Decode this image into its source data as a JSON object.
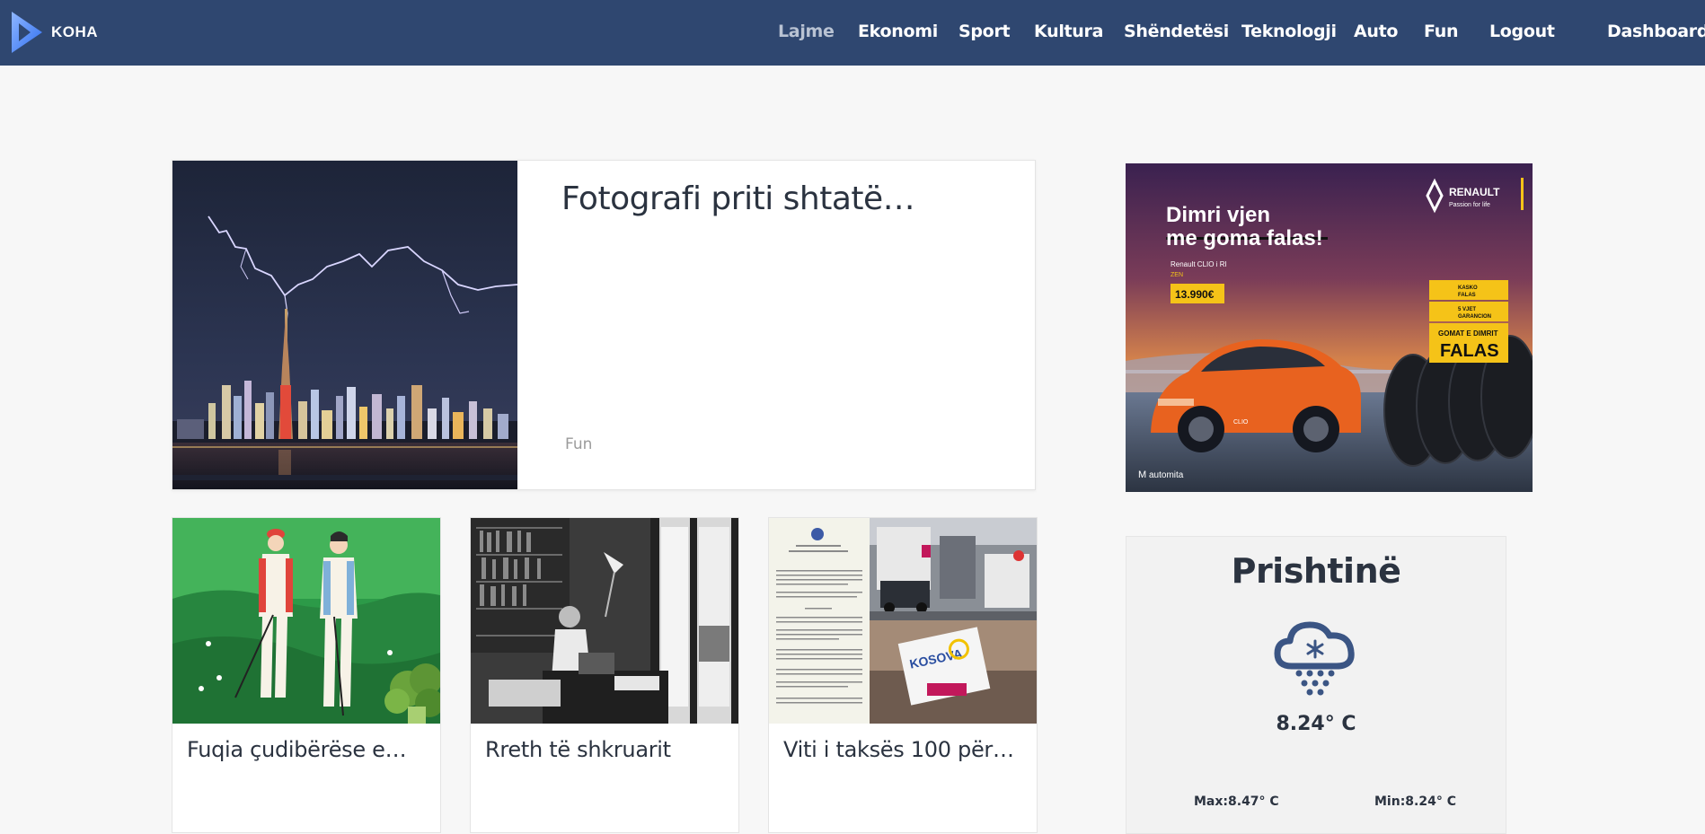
{
  "brand": {
    "name": "KOHA",
    "logo_icon": "play-triangle-icon"
  },
  "nav": {
    "items": [
      {
        "label": "Lajme",
        "active": true
      },
      {
        "label": "Ekonomi"
      },
      {
        "label": "Sport"
      },
      {
        "label": "Kultura"
      },
      {
        "label": "Shëndetësi"
      },
      {
        "label": "Teknologji"
      },
      {
        "label": "Auto"
      },
      {
        "label": "Fun"
      },
      {
        "label": "Logout"
      },
      {
        "label": "Dashboard"
      }
    ]
  },
  "featured": {
    "title": "Fotografi priti shtatë…",
    "category": "Fun",
    "image": "lightning-city-skyline"
  },
  "cards": [
    {
      "title": "Fuqia çudibërëse e…",
      "image": "golfers-illustration"
    },
    {
      "title": "Rreth të shkruarit",
      "image": "writer-typewriter-photo"
    },
    {
      "title": "Viti i taksës 100 për…",
      "image": "document-and-border-collage"
    }
  ],
  "ad": {
    "headline_line1": "Dimri vjen",
    "headline_line2": "me goma falas!",
    "brand": "RENAULT",
    "tagline": "Passion for life",
    "model": "Renault CLIO i RI",
    "trim": "ZEN",
    "price": "13.990€",
    "badge1_line1": "KASKO",
    "badge1_line2": "FALAS",
    "badge2_line1": "5 VJET",
    "badge2_line2": "GARANCION",
    "badge3_line1": "GOMAT E DIMRIT",
    "badge3_line2": "FALAS",
    "dealer": "automita",
    "car_plate": "CLIO"
  },
  "weather": {
    "city": "Prishtinë",
    "icon": "snow-cloud-icon",
    "temp": "8.24° C",
    "max": "Max:8.47° C",
    "min": "Min:8.24° C"
  },
  "colors": {
    "navbar": "#2f4770",
    "active_nav": "#b9c3d3",
    "text_dark": "#2b3340",
    "weather_icon": "#3b5584",
    "ad_yellow": "#f5c318"
  }
}
